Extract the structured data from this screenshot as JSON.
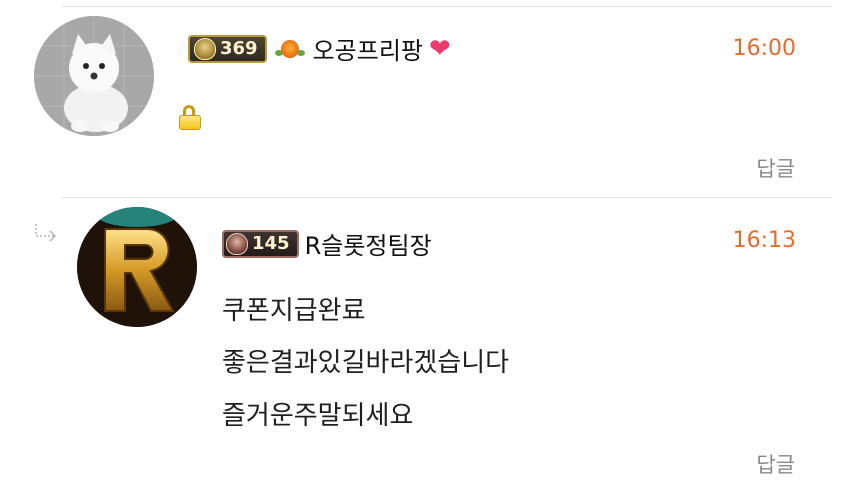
{
  "comments": [
    {
      "level": "369",
      "nickname": "오공프리팡",
      "time": "16:00",
      "reply_label": "답글",
      "avatar_icon": "pomeranian-avatar",
      "locked": true
    },
    {
      "level": "145",
      "nickname": "R슬롯정팀장",
      "time": "16:13",
      "reply_label": "답글",
      "avatar_icon": "letter-r-avatar",
      "avatar_letter": "R",
      "lines": [
        "쿠폰지급완료",
        "좋은결과있길바라겠습니다",
        "즐거운주말되세요"
      ]
    }
  ],
  "colors": {
    "time": "#e46d2c",
    "reply": "#8a8a8a",
    "heart": "#ef3a6f"
  }
}
